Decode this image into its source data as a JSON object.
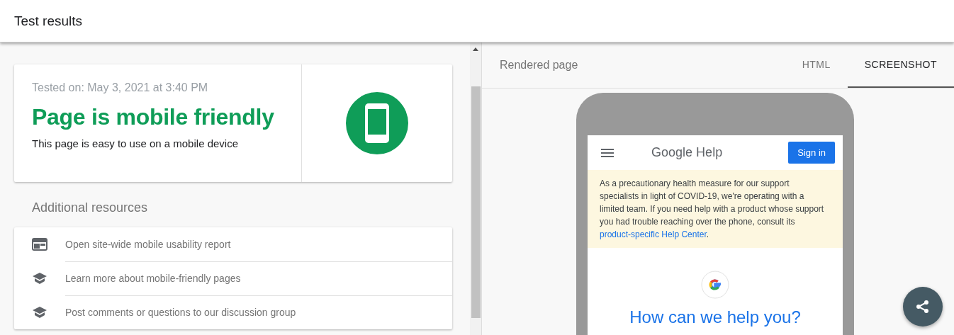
{
  "header": {
    "title": "Test results"
  },
  "result": {
    "tested_on": "Tested on: May 3, 2021 at 3:40 PM",
    "verdict": "Page is mobile friendly",
    "description": "This page is easy to use on a mobile device",
    "friendly": true
  },
  "resources": {
    "heading": "Additional resources",
    "items": [
      {
        "kind": "report",
        "label": "Open site-wide mobile usability report"
      },
      {
        "kind": "learn",
        "label": "Learn more about mobile-friendly pages"
      },
      {
        "kind": "learn",
        "label": "Post comments or questions to our discussion group"
      }
    ]
  },
  "preview": {
    "title": "Rendered page",
    "tabs": [
      {
        "label": "HTML",
        "selected": false
      },
      {
        "label": "SCREENSHOT",
        "selected": true
      }
    ],
    "phone": {
      "site_title": "Google Help",
      "sign_in": "Sign in",
      "notice": "As a precautionary health measure for our support specialists in light of COVID-19, we're operating with a limited team. If you need help with a product whose support you had trouble reaching over the phone, consult its",
      "notice_link": "product-specific Help Center",
      "notice_end": ".",
      "heading": "How can we help you?"
    }
  }
}
